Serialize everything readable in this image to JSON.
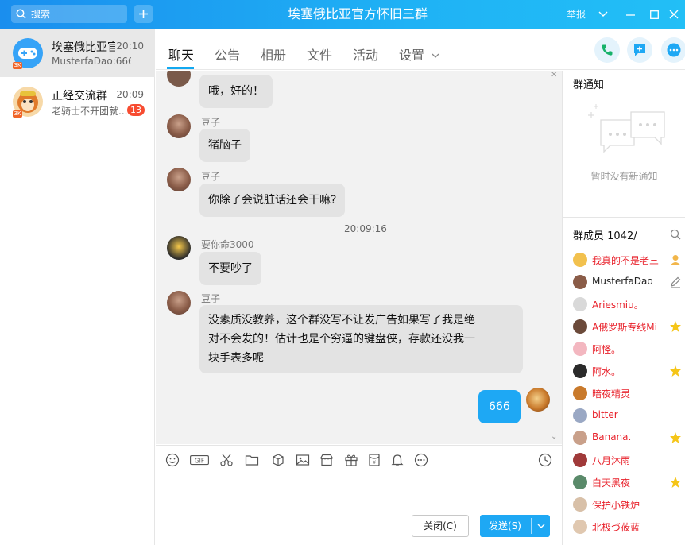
{
  "window": {
    "title": "埃塞俄比亚官方怀旧三群",
    "report_label": "举报",
    "search_placeholder": "搜索"
  },
  "conversations": [
    {
      "name": "埃塞俄比亚官方怀旧三群",
      "time": "20:10",
      "preview": "MusterfaDao:666",
      "active": true
    },
    {
      "name": "正经交流群",
      "time": "20:09",
      "preview": "老骑士不开团就...",
      "unread": "13"
    }
  ],
  "tabs": [
    "聊天",
    "公告",
    "相册",
    "文件",
    "活动",
    "设置"
  ],
  "messages": [
    {
      "sender": "",
      "text": "哦，好的！"
    },
    {
      "sender": "豆子",
      "text": "猪脑子"
    },
    {
      "sender": "豆子",
      "text": "你除了会说脏话还会干嘛?"
    },
    {
      "timestamp": "20:09:16"
    },
    {
      "sender": "要你命3000",
      "text": "不要吵了"
    },
    {
      "sender": "豆子",
      "lines": [
        "没素质没教养，这个群没写不让发广告如果写了我是绝",
        "对不会发的！估计也是个穷逼的键盘侠，存款还没我一",
        "块手表多呢"
      ]
    },
    {
      "sender": "me",
      "text": "666"
    }
  ],
  "composer": {
    "close_label": "关闭(C)",
    "send_label": "发送(S)"
  },
  "group_notice": {
    "title": "群通知",
    "empty_text": "暂时没有新通知"
  },
  "members": {
    "title": "群成员 1042/",
    "list": [
      {
        "name": "我真的不是老三",
        "color": "#e8202a",
        "badge": "owner"
      },
      {
        "name": "MusterfaDao",
        "color": "#222222",
        "badge": "edit"
      },
      {
        "name": "Ariesmiu。",
        "color": "#e8202a",
        "badge": ""
      },
      {
        "name": "A俄罗斯专线Mi",
        "color": "#e8202a",
        "badge": "star"
      },
      {
        "name": "阿怪。",
        "color": "#e8202a",
        "badge": ""
      },
      {
        "name": "阿水。",
        "color": "#e8202a",
        "badge": "star"
      },
      {
        "name": "暗夜精灵",
        "color": "#e8202a",
        "badge": ""
      },
      {
        "name": "bitter",
        "color": "#e8202a",
        "badge": ""
      },
      {
        "name": "Banana.",
        "color": "#e8202a",
        "badge": "star"
      },
      {
        "name": "八月沐雨",
        "color": "#e8202a",
        "badge": ""
      },
      {
        "name": "白天黑夜",
        "color": "#e8202a",
        "badge": "star"
      },
      {
        "name": "保护小铁炉",
        "color": "#e8202a",
        "badge": ""
      },
      {
        "name": "北极づ莜蓝",
        "color": "#e8202a",
        "badge": ""
      }
    ]
  },
  "colors": {
    "accent": "#1ea8f4",
    "member_name": "#e8202a",
    "unread_badge": "#f74c31"
  }
}
